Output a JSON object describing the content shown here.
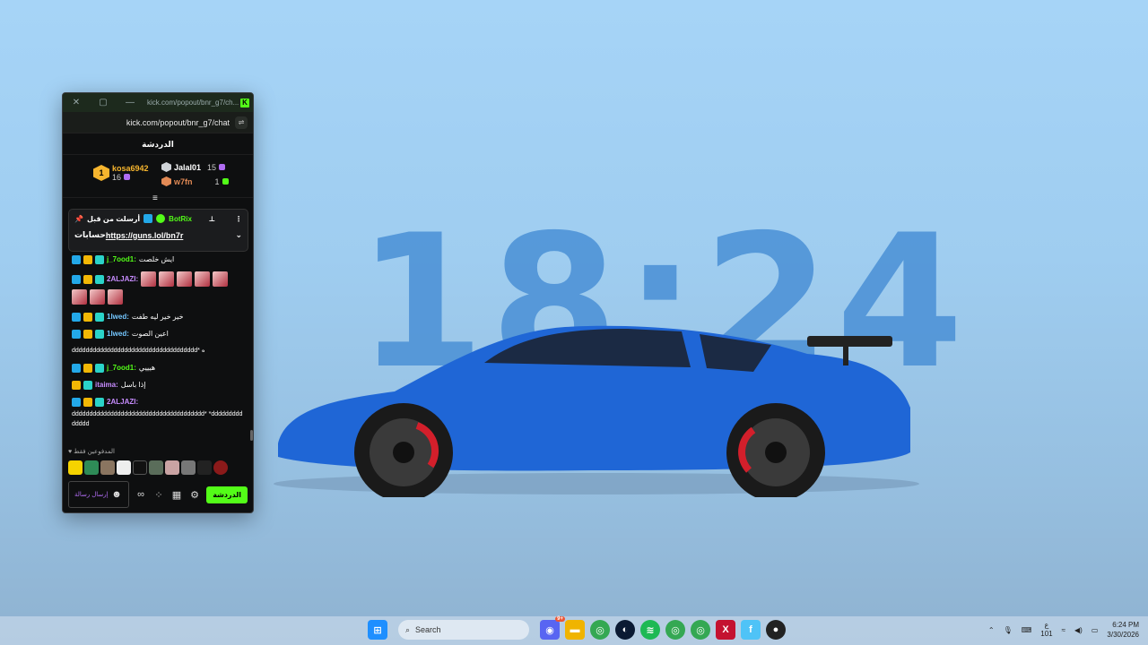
{
  "wallpaper": {
    "clock": "18:24",
    "accent": "#4a90d6"
  },
  "window": {
    "title_url": "kick.com/popout/bnr_g7/ch...",
    "address": "kick.com/popout/bnr_g7/chat",
    "chat_header": "الدردشة"
  },
  "leaderboard": {
    "first": {
      "rank": "1",
      "name": "kosa6942",
      "count": "16"
    },
    "second": {
      "name": "Jalal01",
      "count": "15"
    },
    "third": {
      "name": "w7fn",
      "count": "1"
    }
  },
  "pinned": {
    "sent_by": "أرسلت من قبل",
    "bot": "BotRix",
    "prefix": "حسابات",
    "link": "https://guns.lol/bn7r"
  },
  "messages": [
    {
      "user": "j_7ood1:",
      "color": "u-green",
      "text": "ايش خلصت"
    },
    {
      "user": "2ALJAZI:",
      "color": "u-purple",
      "text": "",
      "emotes": 8
    },
    {
      "user": "1lwed:",
      "color": "u-blue",
      "text": "خير خير ليه طفت"
    },
    {
      "user": "1lwed:",
      "color": "u-blue",
      "text": "اعين الصوت"
    },
    {
      "user": "",
      "color": "u-green",
      "text": "dddddddddddddddddddddddddddddddddddd* ه"
    },
    {
      "user": "j_7ood1:",
      "color": "u-green",
      "text": "هيييي"
    },
    {
      "user": "itaima:",
      "color": "u-purple",
      "text": "إذا باسل"
    },
    {
      "user": "2ALJAZI:",
      "color": "u-purple",
      "text": "dddddddddddddddddddddddddddddddddddddd* *dddddddddddddd"
    }
  ],
  "emote_bar_label": "المدفوعين فقط",
  "input": {
    "placeholder": "إرسال رسالة"
  },
  "send_label": "الدردشة",
  "taskbar": {
    "search": "Search",
    "lang": "ع",
    "lang_sub": "101",
    "time": "6:24 PM",
    "date": "3/30/2026",
    "discord_badge": "9+"
  }
}
